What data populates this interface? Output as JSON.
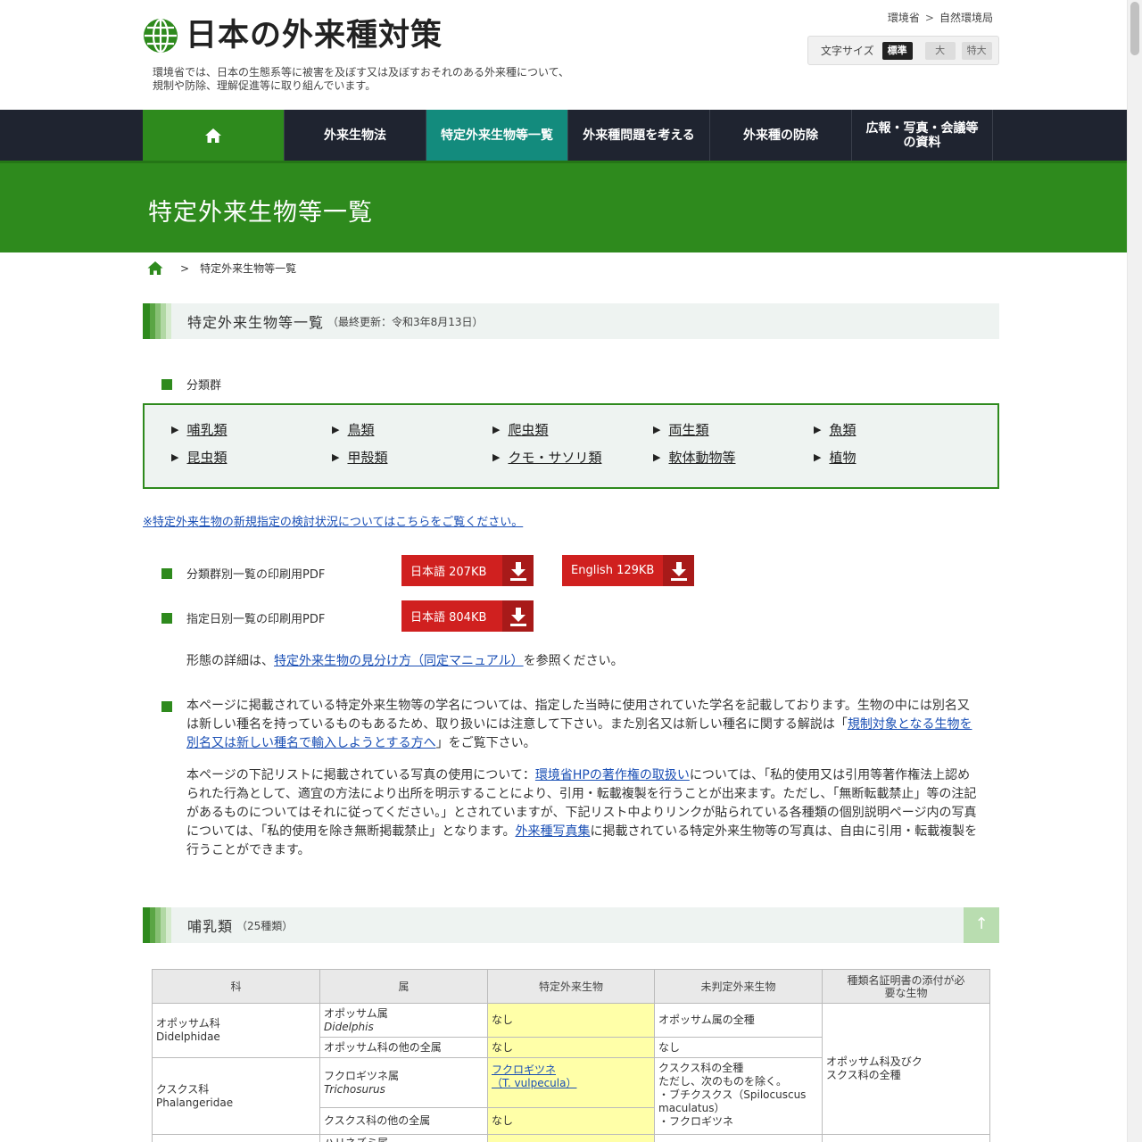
{
  "header": {
    "site_title": "日本の外来種対策",
    "tagline_1": "環境省では、日本の生態系等に被害を及ぼす又は及ぼすおそれのある外来種について、",
    "tagline_2": "規制や防除、理解促進等に取り組んでいます。",
    "topnav": [
      "環境省",
      "自然環境局"
    ],
    "fontsize_label": "文字サイズ",
    "fontsize_options": [
      "標準",
      "大",
      "特大"
    ]
  },
  "nav": {
    "items": [
      "外来生物法",
      "特定外来生物等一覧",
      "外来種問題を考える",
      "外来種の防除",
      "広報・写真・会議等の資料"
    ]
  },
  "page": {
    "title": "特定外来生物等一覧",
    "breadcrumb_current": "特定外来生物等一覧"
  },
  "section1": {
    "title": "特定外来生物等一覧",
    "sub": "（最終更新：令和3年8月13日）"
  },
  "categories": {
    "label": "分類群",
    "items": [
      "哺乳類",
      "鳥類",
      "爬虫類",
      "両生類",
      "魚類",
      "昆虫類",
      "甲殻類",
      "クモ・サソリ類",
      "軟体動物等",
      "植物"
    ]
  },
  "notice_link": "※特定外来生物の新規指定の検討状況についてはこちらをご覧ください。",
  "pdf": {
    "row1_label": "分類群別一覧の印刷用PDF",
    "row1_jp": "日本語 207KB",
    "row1_en": "English 129KB",
    "row2_label": "指定日別一覧の印刷用PDF",
    "row2_jp": "日本語 804KB"
  },
  "detail": {
    "prefix": "形態の詳細は、",
    "link": "特定外来生物の見分け方（同定マニュアル）",
    "suffix": "を参照ください。"
  },
  "note1": {
    "text_a": "本ページに掲載されている特定外来生物等の学名については、指定した当時に使用されていた学名を記載しております。生物の中には別名又は新しい種名を持っているものもあるため、取り扱いには注意して下さい。また別名又は新しい種名に関する解説は「",
    "link": "規制対象となる生物を別名又は新しい種名で輸入しようとする方へ",
    "text_b": "」をご覧下さい。"
  },
  "note2": {
    "text_a": "本ページの下記リストに掲載されている写真の使用について：",
    "link1": "環境省HPの著作権の取扱い",
    "text_b": "については、「私的使用又は引用等著作権法上認められた行為として、適宜の方法により出所を明示することにより、引用・転載複製を行うことが出来ます。ただし、「無断転載禁止」等の注記があるものについてはそれに従ってください。」とされていますが、下記リスト中よりリンクが貼られている各種類の個別説明ページ内の写真については、「私的使用を除き無断掲載禁止」となります。",
    "link2": "外来種写真集",
    "text_c": "に掲載されている特定外来生物等の写真は、自由に引用・転載複製を行うことができます。"
  },
  "section2": {
    "title": "哺乳類",
    "sub": "（25種類）",
    "totop": "↑"
  },
  "table": {
    "headers": [
      "科",
      "属",
      "特定外来生物",
      "未判定外来生物",
      "種類名証明書の添付が必要な生物"
    ],
    "r1_family": "オポッサム科",
    "r1_family_latin": "Didelphidae",
    "r1_genus": "オポッサム属",
    "r1_genus_latin": "Didelphis",
    "r1_specified": "なし",
    "r1_unjudged": "オポッサム属の全種",
    "r1_cert": "オポッサム科及びクスクス科の全種",
    "r2_genus": "オポッサム科の他の全属",
    "r2_specified": "なし",
    "r2_unjudged": "なし",
    "r3_family": "クスクス科",
    "r3_family_latin": "Phalangeridae",
    "r3_genus": "フクロギツネ属",
    "r3_genus_latin": "Trichosurus",
    "r3_specified": "フクロギツネ",
    "r3_specified_latin": "（T. vulpecula）",
    "r3_unjudged_1": "クスクス科の全種",
    "r3_unjudged_2": "ただし、次のものを除く。",
    "r3_unjudged_3": "・ブチクスクス（Spilocuscus maculatus）",
    "r3_unjudged_4": "・フクロギツネ",
    "r4_genus": "クスクス科の他の全属",
    "r4_specified": "なし",
    "r5_genus": "ハリネズミ属"
  }
}
